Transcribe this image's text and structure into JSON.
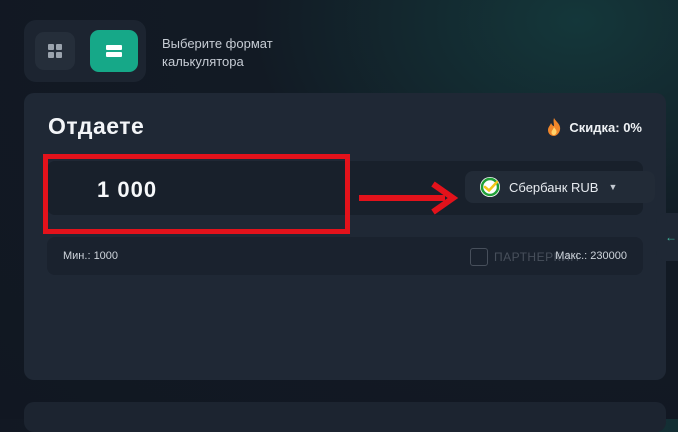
{
  "format_hint": "Выберите формат калькулятора",
  "card": {
    "title": "Отдаете",
    "discount_label": "Скидка: 0%",
    "amount": "1 000",
    "currency": "Сбербанк RUB",
    "min_label": "Мин.:",
    "min_value": "1000",
    "max_label": "Макс.:",
    "max_value": "230000"
  },
  "watermark": "ПАРТНЕРКИН",
  "icons": {
    "grid": "grid-icon",
    "list": "list-icon",
    "discount": "flame-icon",
    "currency": "sberbank-icon",
    "caret": "caret-down-icon",
    "side": "arrow-left-icon"
  },
  "colors": {
    "accent": "#16a888",
    "annotation": "#e3121b",
    "card_bg": "#1f2835"
  }
}
